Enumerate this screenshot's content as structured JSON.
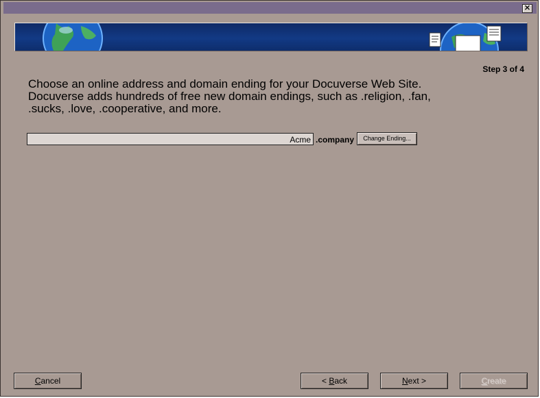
{
  "window": {
    "close_icon": "close-icon",
    "close_glyph": "✕"
  },
  "banner": {
    "left_icon": "globe-icon",
    "right_icon": "globe-with-documents-icon",
    "colors": {
      "banner": "#123a85",
      "dialog": "#a89a93",
      "titlebar": "#7a6c8c"
    }
  },
  "step": "Step 3 of 4",
  "intro": {
    "line1": "Choose an online address and domain ending for your Docuverse Web Site.",
    "line2": "Docuverse adds hundreds of free new domain endings, such as .religion, .fan,",
    "line3": ".sucks, .love, .cooperative, and more."
  },
  "address": {
    "value": "Acme",
    "ending": ".company",
    "change_label": "Change Ending..."
  },
  "buttons": {
    "cancel_u": "C",
    "cancel_rest": "ancel",
    "back_prefix": "< ",
    "back_u": "B",
    "back_rest": "ack",
    "next_u": "N",
    "next_rest": "ext >",
    "create_u": "C",
    "create_rest": "reate"
  }
}
